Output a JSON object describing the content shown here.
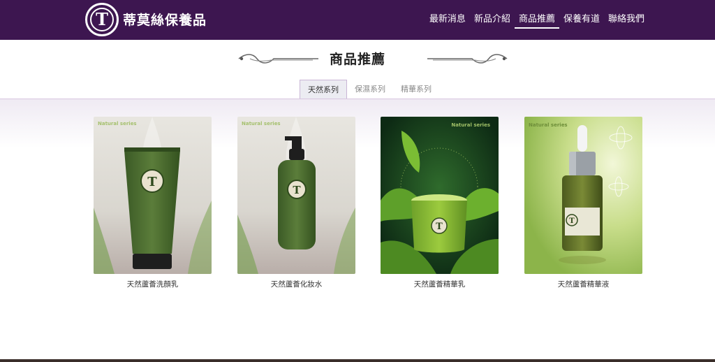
{
  "header": {
    "logo_letter": "T",
    "brand": "蒂莫絲保養品",
    "nav": [
      "最新消息",
      "新品介紹",
      "商品推薦",
      "保養有道",
      "聯絡我們"
    ],
    "active_nav": 2
  },
  "section": {
    "title": "商品推薦"
  },
  "tabs": {
    "items": [
      "天然系列",
      "保濕系列",
      "精華系列"
    ],
    "active": 0
  },
  "products": [
    {
      "name": "天然蘆薈洗顏乳",
      "tag": "Natural series"
    },
    {
      "name": "天然蘆薈化妝水",
      "tag": "Natural series"
    },
    {
      "name": "天然蘆薈精華乳",
      "tag": "Natural series"
    },
    {
      "name": "天然蘆薈精華液",
      "tag": "Natural series"
    }
  ],
  "colors": {
    "header_bg": "#3d1650",
    "accent": "#c9b6d6",
    "product_green": "#4a6a2e"
  }
}
